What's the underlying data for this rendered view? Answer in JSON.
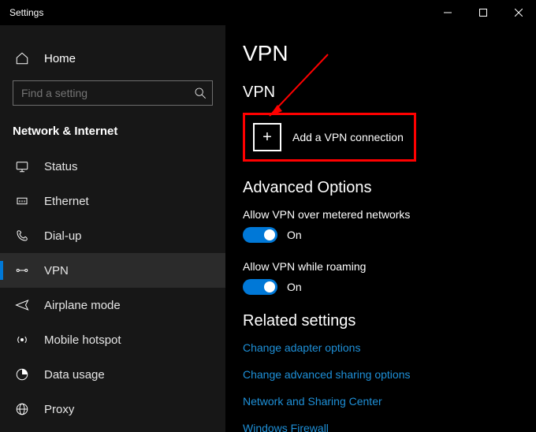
{
  "window": {
    "title": "Settings"
  },
  "sidebar": {
    "home": "Home",
    "search_placeholder": "Find a setting",
    "category": "Network & Internet",
    "items": [
      {
        "label": "Status"
      },
      {
        "label": "Ethernet"
      },
      {
        "label": "Dial-up"
      },
      {
        "label": "VPN"
      },
      {
        "label": "Airplane mode"
      },
      {
        "label": "Mobile hotspot"
      },
      {
        "label": "Data usage"
      },
      {
        "label": "Proxy"
      }
    ]
  },
  "main": {
    "page_title": "VPN",
    "section_vpn": "VPN",
    "add_vpn": "Add a VPN connection",
    "advanced_options": "Advanced Options",
    "opt_metered": {
      "label": "Allow VPN over metered networks",
      "state": "On"
    },
    "opt_roaming": {
      "label": "Allow VPN while roaming",
      "state": "On"
    },
    "related_title": "Related settings",
    "links": [
      "Change adapter options",
      "Change advanced sharing options",
      "Network and Sharing Center",
      "Windows Firewall"
    ]
  },
  "colors": {
    "accent": "#0078d7",
    "highlight": "#ff0000",
    "link": "#1e90d8"
  }
}
